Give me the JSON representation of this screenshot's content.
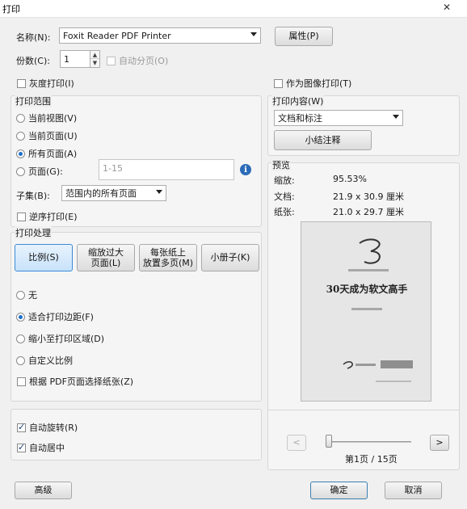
{
  "window": {
    "title": "打印",
    "close_glyph": "✕"
  },
  "printer": {
    "label": "名称(N):",
    "selected": "Foxit Reader PDF Printer",
    "properties_button": "属性(P)"
  },
  "copies": {
    "label": "份数(C):",
    "value": "1",
    "collate_label": "自动分页(O)"
  },
  "grayscale_label": "灰度打印(I)",
  "print_as_image_label": "作为图像打印(T)",
  "print_range": {
    "title": "打印范围",
    "current_view": "当前视图(V)",
    "current_page": "当前页面(U)",
    "all_pages": "所有页面(A)",
    "pages": "页面(G):",
    "pages_value": "1-15",
    "subset_label": "子集(B):",
    "subset_selected": "范围内的所有页面",
    "reverse_label": "逆序打印(E)"
  },
  "print_what": {
    "title": "打印内容(W)",
    "selected": "文档和标注",
    "summarize_button": "小结注释"
  },
  "page_handling": {
    "title": "打印处理",
    "tabs": [
      {
        "label": "比例(S)"
      },
      {
        "label": "缩放过大\n页面(L)"
      },
      {
        "label": "每张纸上\n放置多页(M)"
      },
      {
        "label": "小册子(K)"
      }
    ],
    "none": "无",
    "fit_margins": "适合打印边距(F)",
    "shrink": "缩小至打印区域(D)",
    "custom": "自定义比例",
    "choose_paper": "根据 PDF页面选择纸张(Z)"
  },
  "auto_rotate_label": "自动旋转(R)",
  "auto_center_label": "自动居中",
  "preview": {
    "title": "预览",
    "zoom_label": "缩放:",
    "zoom_value": "95.53%",
    "doc_label": "文档:",
    "doc_value": "21.9 x 30.9 厘米",
    "paper_label": "纸张:",
    "paper_value": "21.0 x 29.7 厘米",
    "page_heading": "30天成为软文高手",
    "page_indicator": "第1页 / 15页",
    "prev_glyph": "<",
    "next_glyph": ">",
    "current_page": 1,
    "total_pages": 15
  },
  "footer": {
    "advanced_button": "高级",
    "ok_button": "确定",
    "cancel_button": "取消"
  },
  "colors": {
    "accent": "#3d8ad6",
    "radio_dot": "#1d6fcc"
  }
}
